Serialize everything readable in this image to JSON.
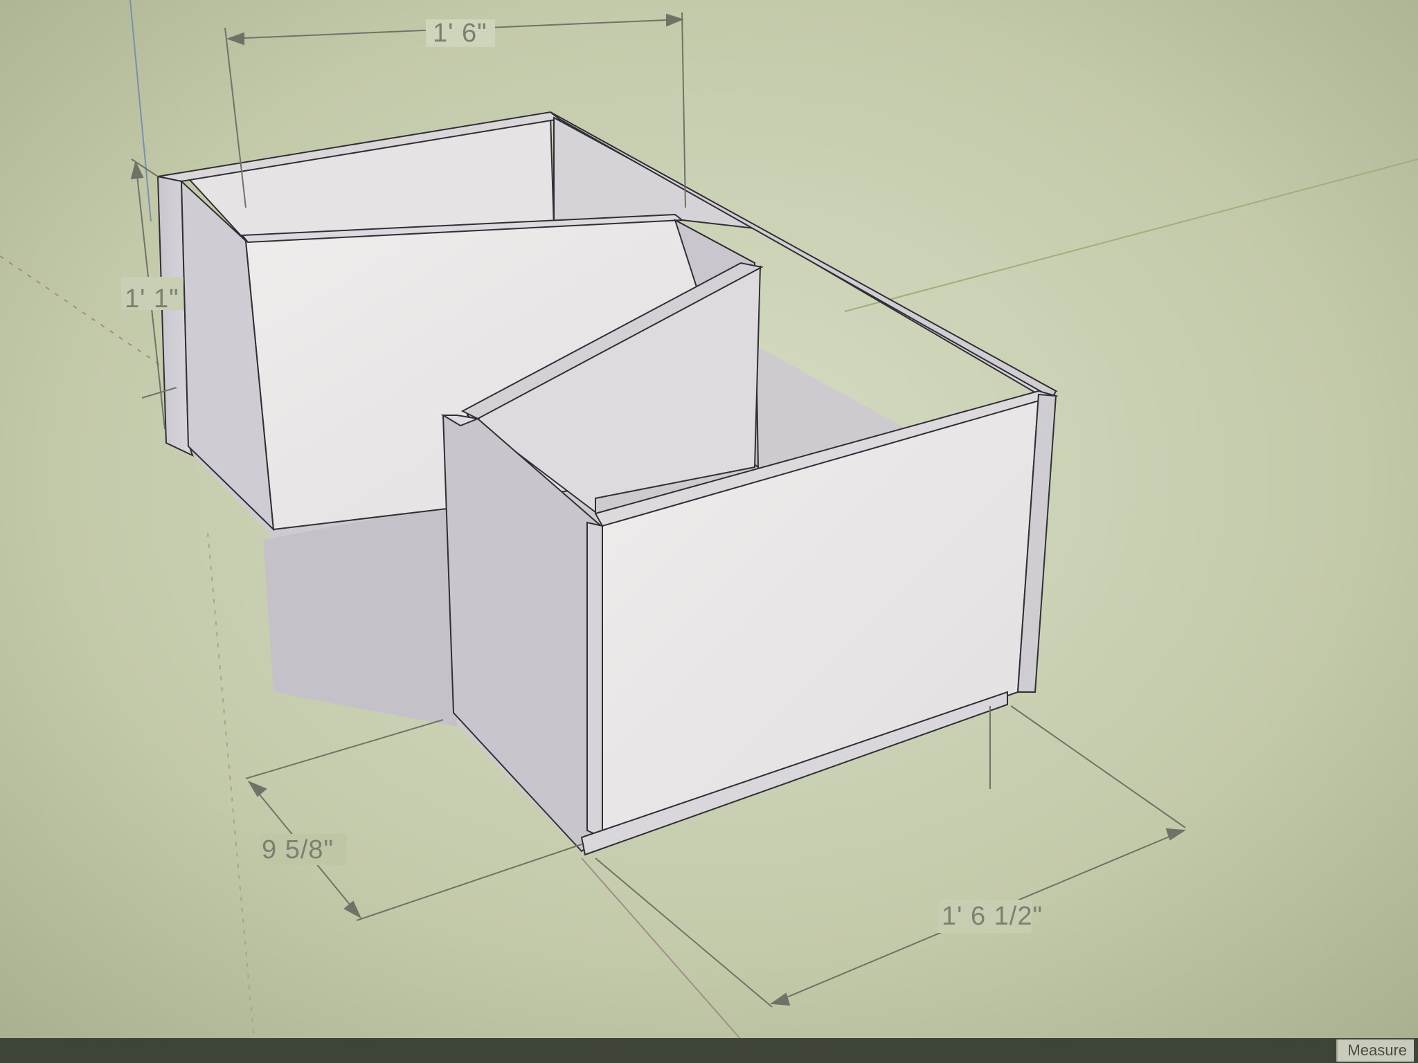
{
  "app": {
    "status_bar": {
      "measurement_label": "Measure"
    }
  },
  "model": {
    "dimensions": {
      "top_width": "1' 6\"",
      "height": "1' 1\"",
      "front_depth": "9 5/8\"",
      "side_length": "1' 6 1/2\""
    }
  },
  "colors": {
    "background": "#c8cfb4",
    "panel_front": "#ece9ea",
    "panel_side": "#d5d3d8",
    "panel_inner": "#e3e0e2",
    "floor": "#cfcdd1",
    "edge": "#2c2c30",
    "dimension_line": "#6f7366"
  }
}
